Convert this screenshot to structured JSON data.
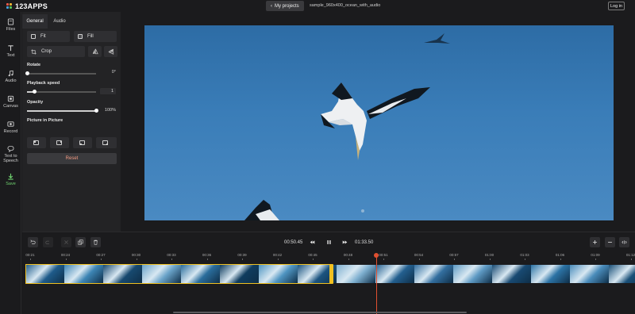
{
  "app": {
    "logo": "123APPS",
    "my_projects": "My projects",
    "filename": "sample_960x400_ocean_with_audio",
    "login": "Log in"
  },
  "rail": [
    {
      "label": "Files",
      "icon": "file-icon"
    },
    {
      "label": "Text",
      "icon": "text-icon"
    },
    {
      "label": "Audio",
      "icon": "music-note-icon"
    },
    {
      "label": "Canvas",
      "icon": "canvas-icon"
    },
    {
      "label": "Record",
      "icon": "record-icon"
    },
    {
      "label": "Text to Speech",
      "icon": "speech-icon"
    },
    {
      "label": "Save",
      "icon": "download-icon"
    }
  ],
  "panel": {
    "tabs": [
      "General",
      "Audio"
    ],
    "active_tab": "General",
    "fit_label": "Fit",
    "fill_label": "Fill",
    "crop_label": "Crop",
    "rotate": {
      "label": "Rotate",
      "value": "0°",
      "level": 0
    },
    "speed": {
      "label": "Playback speed",
      "value": "1",
      "level": 0.1
    },
    "opacity": {
      "label": "Opacity",
      "value": "100%",
      "level": 1
    },
    "pip_label": "Picture in Picture",
    "reset_label": "Reset"
  },
  "colors": {
    "accent_save": "#6fd36f",
    "reset_text": "#f29a82",
    "selection": "#f0c020",
    "playhead": "#e05030"
  },
  "timeline": {
    "current_time": "00:50.45",
    "total_time": "01:33.50",
    "ticks": [
      "00:21",
      "00:24",
      "00:27",
      "00:30",
      "00:33",
      "00:36",
      "00:39",
      "00:42",
      "00:45",
      "00:48",
      "00:51",
      "00:54",
      "00:57",
      "01:00",
      "01:03",
      "01:06",
      "01:09",
      "01:12"
    ]
  }
}
